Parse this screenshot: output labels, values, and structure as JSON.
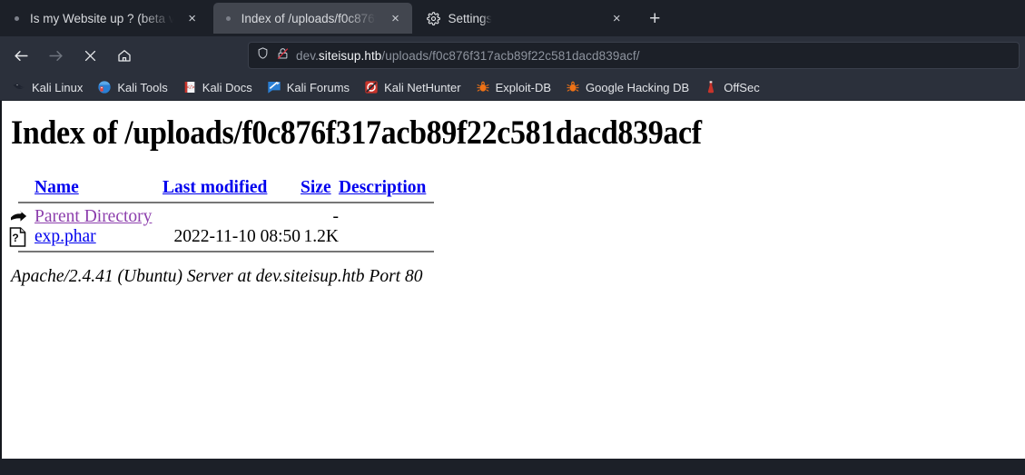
{
  "browser": {
    "tabs": [
      {
        "title": "Is my Website up ? (beta v",
        "favicon": "dot-icon",
        "active": false,
        "close": "×"
      },
      {
        "title": "Index of /uploads/f0c876f",
        "favicon": "dot-icon",
        "active": true,
        "close": "×"
      },
      {
        "title": "Settings",
        "favicon": "gear-icon",
        "active": false,
        "close": "×"
      }
    ],
    "new_tab_label": "+",
    "nav": {
      "back": "back-arrow-icon",
      "forward": "forward-arrow-icon",
      "stop": "stop-x-icon",
      "home": "home-icon"
    },
    "urlbar": {
      "shield_icon": "shield-icon",
      "lock_icon": "lock-crossed-icon",
      "url_prefix": "dev.",
      "url_host": "siteisup.htb",
      "url_path": "/uploads/f0c876f317acb89f22c581dacd839acf/",
      "full_url": "dev.siteisup.htb/uploads/f0c876f317acb89f22c581dacd839acf/"
    },
    "bookmarks": [
      {
        "label": "Kali Linux",
        "icon": "kali-dragon-icon"
      },
      {
        "label": "Kali Tools",
        "icon": "kali-tools-icon"
      },
      {
        "label": "Kali Docs",
        "icon": "kali-docs-icon"
      },
      {
        "label": "Kali Forums",
        "icon": "kali-forums-icon"
      },
      {
        "label": "Kali NetHunter",
        "icon": "kali-nethunter-icon"
      },
      {
        "label": "Exploit-DB",
        "icon": "exploit-db-icon"
      },
      {
        "label": "Google Hacking DB",
        "icon": "google-hacking-db-icon"
      },
      {
        "label": "OffSec",
        "icon": "offsec-icon"
      }
    ]
  },
  "page": {
    "heading": "Index of /uploads/f0c876f317acb89f22c581dacd839acf",
    "columns": {
      "name": "Name",
      "last_modified": "Last modified",
      "size": "Size",
      "description": "Description"
    },
    "rows": [
      {
        "icon": "parent-directory-icon",
        "name": "Parent Directory",
        "last_modified": "",
        "size": "-",
        "description": ""
      },
      {
        "icon": "unknown-file-icon",
        "name": "exp.phar",
        "last_modified": "2022-11-10 08:50",
        "size": "1.2K",
        "description": ""
      }
    ],
    "footer": "Apache/2.4.41 (Ubuntu) Server at dev.siteisup.htb Port 80"
  },
  "colors": {
    "chrome_dark": "#1c2028",
    "chrome_bar": "#2b303b",
    "tab_active": "#42464f",
    "link_blue": "#0000ee",
    "link_visited": "#8d3fad",
    "page_bg": "#ffffff"
  }
}
